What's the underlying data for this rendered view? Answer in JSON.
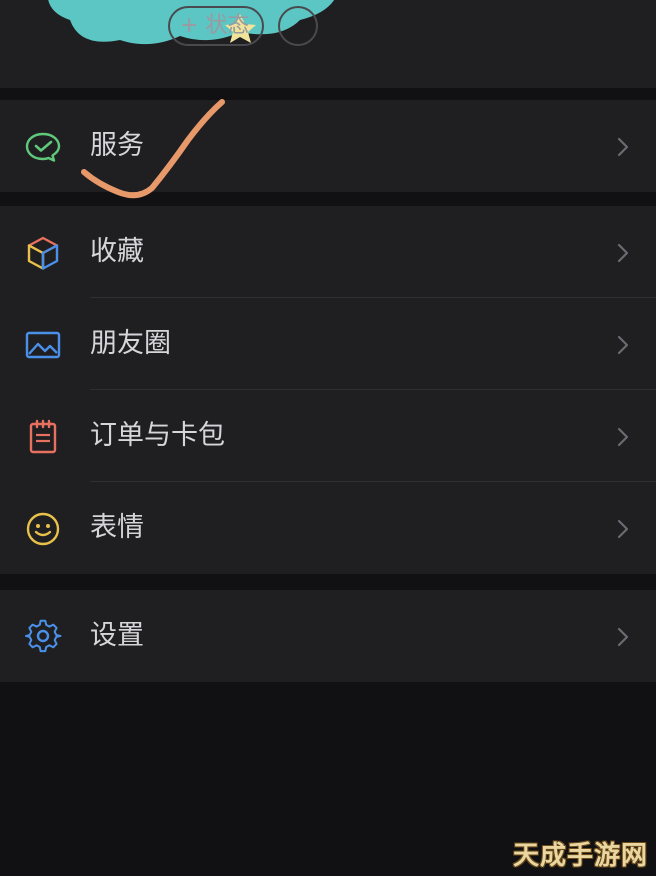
{
  "header": {
    "status_button_label": "+ 状态"
  },
  "menu": {
    "services": {
      "label": "服务",
      "icon": "wechat-pay-icon",
      "color": "#5fc87a"
    },
    "favorites": {
      "label": "收藏",
      "icon": "cube-icon"
    },
    "moments": {
      "label": "朋友圈",
      "icon": "image-icon",
      "color": "#4a8fe8"
    },
    "orders": {
      "label": "订单与卡包",
      "icon": "notepad-icon",
      "color": "#e8705f"
    },
    "stickers": {
      "label": "表情",
      "icon": "smiley-icon",
      "color": "#e8c04a"
    },
    "settings": {
      "label": "设置",
      "icon": "gear-icon",
      "color": "#4a8fe8"
    }
  },
  "annotation": {
    "color": "#e8996a"
  },
  "watermark": {
    "text": "天成手游网"
  }
}
